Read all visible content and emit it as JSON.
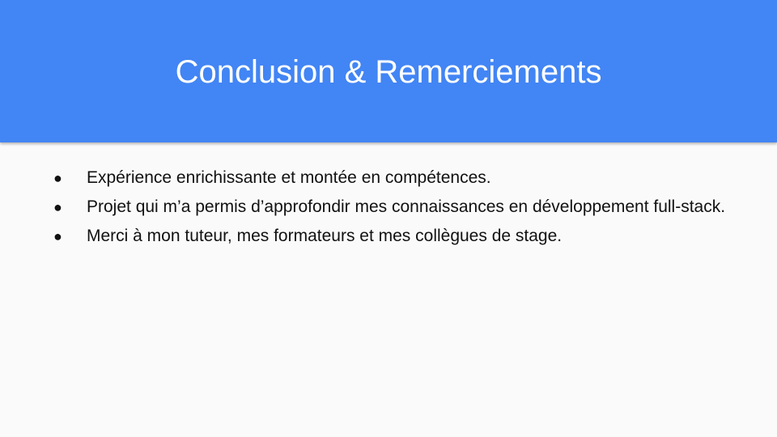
{
  "slide": {
    "title": "Conclusion & Remerciements",
    "bullets": [
      "Expérience enrichissante et montée en compétences.",
      "Projet qui m’a permis d’approfondir mes connaissances en développement full-stack.",
      "Merci à mon tuteur, mes formateurs et mes collègues de stage."
    ],
    "bullet_glyph": "●"
  },
  "colors": {
    "header_background": "#4285f4",
    "title_text": "#ffffff",
    "body_background": "#fafafa",
    "body_text": "#111111"
  }
}
